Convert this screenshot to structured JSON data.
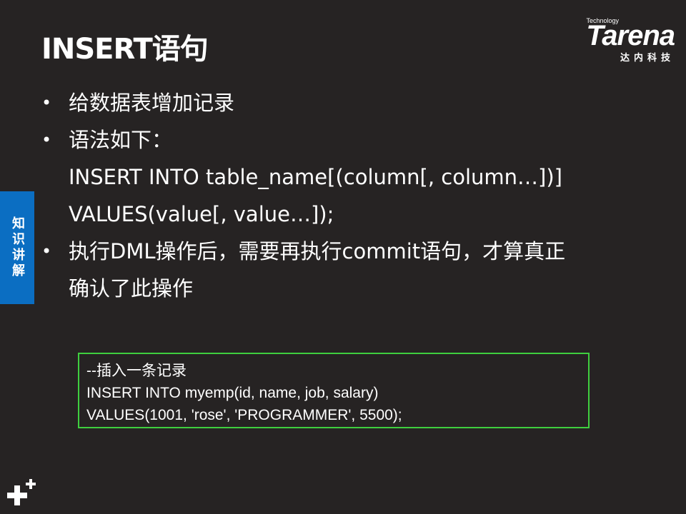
{
  "slide": {
    "title": "INSERT语句"
  },
  "logo": {
    "small": "Technology",
    "brand": "Tarena",
    "cn": "达内科技"
  },
  "side_tab": {
    "label": "知识讲解",
    "color": "#0b6ec2"
  },
  "content": {
    "bullet1": "给数据表增加记录",
    "bullet2": "语法如下：",
    "syntax1": "INSERT INTO table_name[(column[, column…])]",
    "syntax2": "VALUES(value[, value…]);",
    "bullet3_line1": "执行DML操作后，需要再执行commit语句，才算真正",
    "bullet3_line2": "确认了此操作"
  },
  "code_example": {
    "border_color": "#3fcf3f",
    "lines": [
      "--插入一条记录",
      "INSERT INTO myemp(id, name, job, salary)",
      "VALUES(1001, 'rose', 'PROGRAMMER', 5500);"
    ]
  },
  "icons": {
    "corner": "plus-icon"
  }
}
